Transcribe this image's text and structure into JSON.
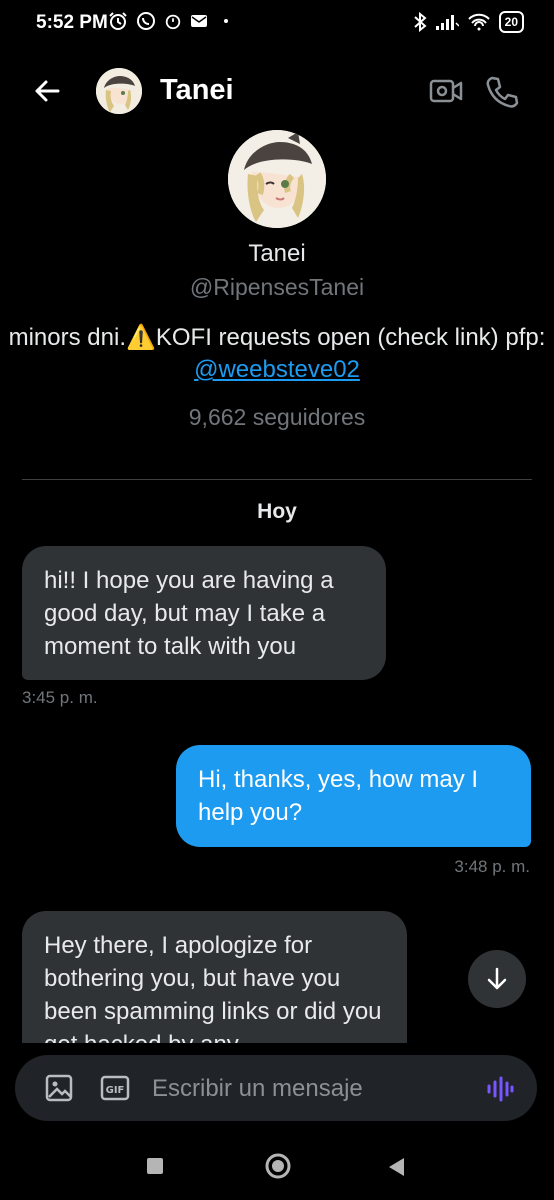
{
  "status_bar": {
    "time": "5:52 PM",
    "left_icons": [
      "alarm-icon",
      "whatsapp-icon",
      "alarm-icon",
      "mail-icon",
      "dot-icon"
    ],
    "right_icons": [
      "bluetooth-icon",
      "signal-icon",
      "wifi-icon"
    ],
    "battery": "20"
  },
  "header": {
    "title": "Tanei",
    "icons": [
      "back-arrow-icon",
      "video-call-icon",
      "phone-call-icon"
    ]
  },
  "profile": {
    "name": "Tanei",
    "handle": "@RipensesTanei",
    "bio_text": "minors dni.⚠️KOFI requests open (check link) pfp: ",
    "bio_link": "@weebsteve02",
    "followers": "9,662 seguidores"
  },
  "conversation": {
    "day_label": "Hoy",
    "messages": [
      {
        "direction": "in",
        "text": "hi!! I hope you are having a good day, but may I take a moment to talk with you",
        "time": "3:45 p. m."
      },
      {
        "direction": "out",
        "text": "Hi, thanks, yes, how may I help you?",
        "time": "3:48 p. m."
      },
      {
        "direction": "in",
        "text": "Hey there, I apologize for bothering you, but have you been spamming links or did you get hacked by any"
      }
    ]
  },
  "composer": {
    "placeholder": "Escribir un mensaje",
    "icons": [
      "image-icon",
      "gif-icon",
      "voice-icon"
    ]
  },
  "colors": {
    "background": "#000000",
    "outgoing_bubble": "#1d9bf0",
    "incoming_bubble": "#2f3336",
    "secondary_text": "#71767b",
    "link": "#1d9bf0"
  }
}
